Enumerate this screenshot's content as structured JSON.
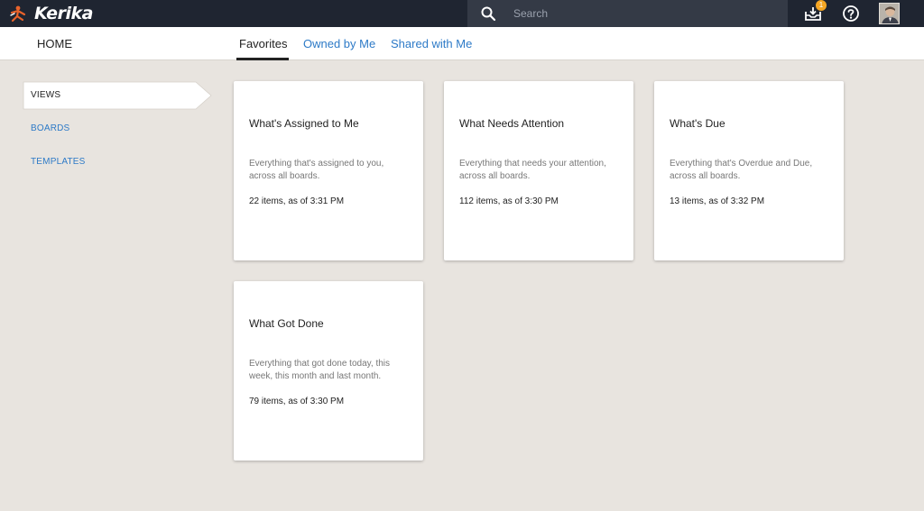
{
  "app": {
    "name": "Kerika"
  },
  "search": {
    "placeholder": "Search"
  },
  "inbox": {
    "badge_count": "1"
  },
  "nav": {
    "home": "HOME",
    "tabs": [
      {
        "label": "Favorites",
        "active": true
      },
      {
        "label": "Owned by Me",
        "active": false
      },
      {
        "label": "Shared with Me",
        "active": false
      }
    ]
  },
  "sidebar": {
    "items": [
      {
        "label": "VIEWS",
        "active": true
      },
      {
        "label": "BOARDS",
        "active": false
      },
      {
        "label": "TEMPLATES",
        "active": false
      }
    ]
  },
  "cards": [
    {
      "title": "What's Assigned to Me",
      "description": "Everything that's assigned to you, across all boards.",
      "count": "22 items, as of 3:31 PM"
    },
    {
      "title": "What Needs Attention",
      "description": "Everything that needs your attention, across all boards.",
      "count": "112 items, as of 3:30 PM"
    },
    {
      "title": "What's Due",
      "description": "Everything that's Overdue and Due, across all boards.",
      "count": "13 items, as of 3:32 PM"
    },
    {
      "title": "What Got Done",
      "description": "Everything that got done today, this week, this month and last month.",
      "count": "79 items, as of 3:30 PM"
    }
  ],
  "colors": {
    "topbar": "#1f2531",
    "accent": "#2d7ac7",
    "background": "#e8e4df",
    "badge": "#f5a623",
    "logo_mark": "#e8632b"
  },
  "icons": [
    "kerika-logo-icon",
    "search-icon",
    "inbox-icon",
    "help-icon",
    "avatar"
  ]
}
